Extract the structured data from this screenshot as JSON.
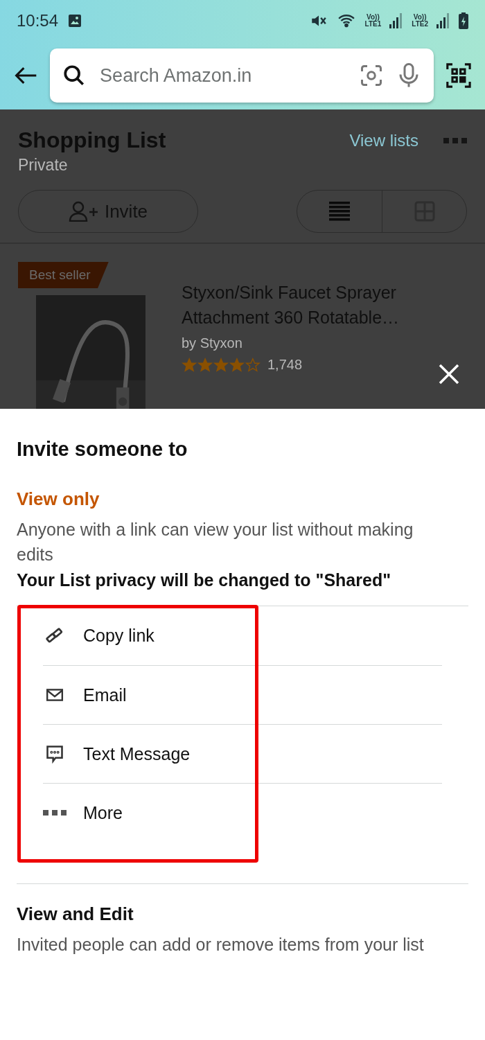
{
  "status_bar": {
    "time": "10:54",
    "sims": [
      {
        "volte": "Vo))",
        "network": "LTE1"
      },
      {
        "volte": "Vo))",
        "network": "LTE2"
      }
    ]
  },
  "search": {
    "placeholder": "Search Amazon.in"
  },
  "list_header": {
    "title": "Shopping List",
    "privacy": "Private",
    "view_lists": "View lists",
    "invite": "Invite",
    "views": [
      {
        "kind": "list",
        "selected": true
      },
      {
        "kind": "grid",
        "selected": false
      }
    ]
  },
  "product": {
    "badge": "Best seller",
    "title": "Styxon/Sink Faucet Sprayer Attachment 360 Rotatable…",
    "brand": "by Styxon",
    "stars": 4,
    "rating_count": "1,748"
  },
  "sheet": {
    "title": "Invite someone to",
    "sections": [
      {
        "heading": "View only",
        "selected": true,
        "description": "Anyone with a link can view your list without making edits",
        "note": "Your List privacy will be changed to \"Shared\"",
        "options": [
          {
            "kind": "link",
            "label": "Copy link"
          },
          {
            "kind": "email",
            "label": "Email"
          },
          {
            "kind": "sms",
            "label": "Text Message"
          },
          {
            "kind": "more",
            "label": "More"
          }
        ]
      },
      {
        "heading": "View and Edit",
        "selected": false,
        "description": "Invited people can add or remove items from your list"
      }
    ]
  }
}
